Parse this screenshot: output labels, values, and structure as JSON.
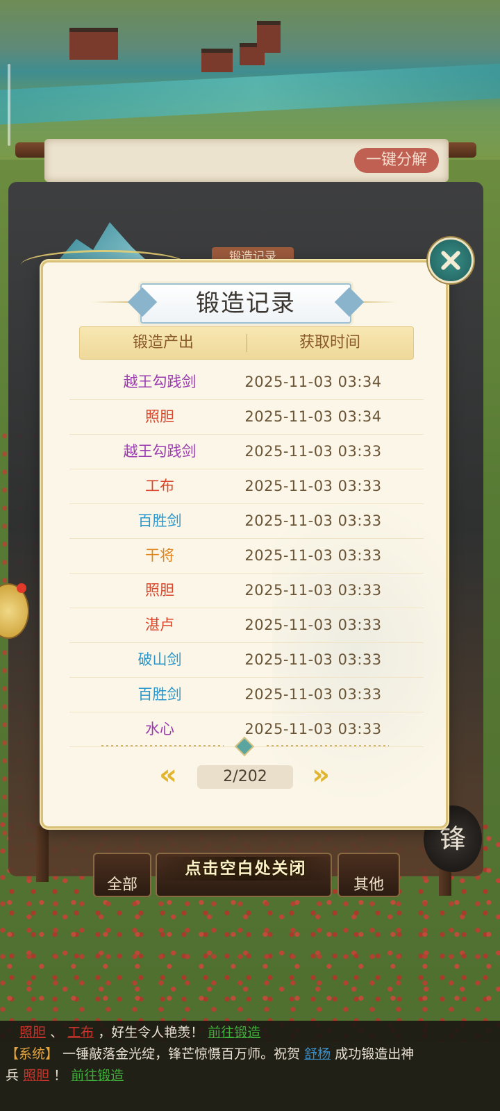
{
  "top_right_button": "一键分解",
  "background_tab": "锻造记录",
  "bottom_tabs": [
    "全部",
    "其他"
  ],
  "forge_seal": "锋",
  "close_hint": "点击空白处关闭",
  "modal": {
    "title": "锻造记录",
    "columns": {
      "output": "锻造产出",
      "time": "获取时间"
    },
    "rows": [
      {
        "item": "越王勾践剑",
        "time": "2025-11-03   03:34",
        "color": "#9b3bb0"
      },
      {
        "item": "照胆",
        "time": "2025-11-03   03:34",
        "color": "#d9452a"
      },
      {
        "item": "越王勾践剑",
        "time": "2025-11-03   03:33",
        "color": "#9b3bb0"
      },
      {
        "item": "工布",
        "time": "2025-11-03   03:33",
        "color": "#d9452a"
      },
      {
        "item": "百胜剑",
        "time": "2025-11-03   03:33",
        "color": "#2a96c9"
      },
      {
        "item": "干将",
        "time": "2025-11-03   03:33",
        "color": "#e0861f"
      },
      {
        "item": "照胆",
        "time": "2025-11-03   03:33",
        "color": "#d9452a"
      },
      {
        "item": "湛卢",
        "time": "2025-11-03   03:33",
        "color": "#d9452a"
      },
      {
        "item": "破山剑",
        "time": "2025-11-03   03:33",
        "color": "#2a96c9"
      },
      {
        "item": "百胜剑",
        "time": "2025-11-03   03:33",
        "color": "#2a96c9"
      },
      {
        "item": "水心",
        "time": "2025-11-03   03:33",
        "color": "#9b3bb0"
      }
    ],
    "pager": {
      "prev": "«",
      "next": "»",
      "page": "2/202"
    }
  },
  "chat": {
    "line1": {
      "a": "照胆",
      "sep": "、",
      "b": "工布",
      "text": "，好生令人艳羡！",
      "link": "前往锻造"
    },
    "line2": {
      "tag": "【系统】",
      "text": "一锤敲落金光绽，锋芒惊慑百万师。祝贺",
      "user": "舒杨",
      "text2": "成功锻造出神"
    },
    "line3": {
      "prefix": "兵",
      "item": "照胆",
      "bang": "！",
      "link": "前往锻造"
    }
  },
  "icons": {
    "close": "close-icon",
    "chat": "chat-bubble-icon"
  }
}
